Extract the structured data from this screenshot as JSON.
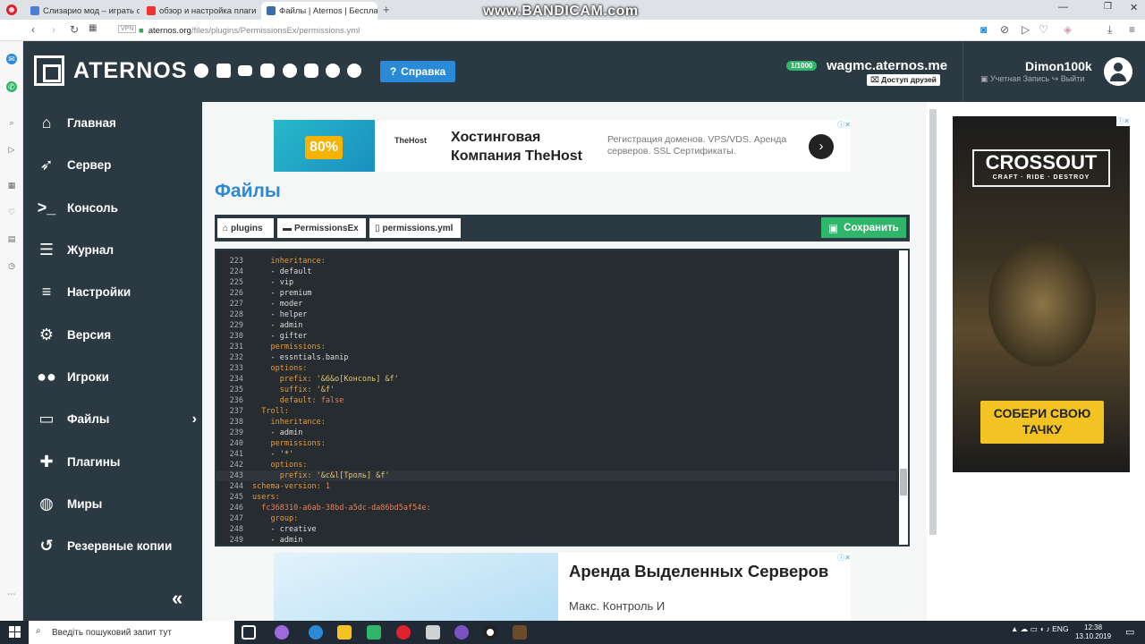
{
  "browser": {
    "tabs": [
      {
        "title": "Слизарио мод – играть он",
        "color": "#4a7fd4"
      },
      {
        "title": "обзор и настройка плаги",
        "color": "#e33"
      },
      {
        "title": "Файлы | Aternos | Бесплат",
        "color": "#3b6ea8"
      }
    ],
    "url_host": "aternos.org",
    "url_path": "/files/plugins/PermissionsEx/permissions.yml",
    "vpn_label": "VPN",
    "new_tab": "+"
  },
  "watermark": "www.BANDICAM.com",
  "header": {
    "logo_text": "ATERNOS",
    "help_label": "Справка",
    "server_badge": "1/1000",
    "server_name": "wagmc.aternos.me",
    "friends_label": "Доступ друзей",
    "user_name": "Dimon100k",
    "account_label": "Учетная Запись",
    "logout_label": "Выйти"
  },
  "sidebar": {
    "items": [
      {
        "label": "Главная",
        "icon": "home-icon"
      },
      {
        "label": "Сервер",
        "icon": "rocket-icon"
      },
      {
        "label": "Консоль",
        "icon": "terminal-icon"
      },
      {
        "label": "Журнал",
        "icon": "log-icon"
      },
      {
        "label": "Настройки",
        "icon": "sliders-icon"
      },
      {
        "label": "Версия",
        "icon": "gears-icon"
      },
      {
        "label": "Игроки",
        "icon": "users-icon"
      },
      {
        "label": "Файлы",
        "icon": "folder-icon"
      },
      {
        "label": "Плагины",
        "icon": "puzzle-icon"
      },
      {
        "label": "Миры",
        "icon": "globe-icon"
      },
      {
        "label": "Резервные копии",
        "icon": "restore-icon"
      }
    ],
    "collapse_label": "«"
  },
  "ad_top": {
    "badge": "80%",
    "brand": "TheHost",
    "title": "Хостинговая Компания TheHost",
    "desc": "Регистрация доменов. VPS/VDS. Аренда серверов. SSL Сертификаты."
  },
  "files": {
    "title": "Файлы",
    "breadcrumbs": [
      "plugins",
      "PermissionsEx",
      "permissions.yml"
    ],
    "save_label": "Сохранить"
  },
  "editor": {
    "lines": [
      {
        "n": "223",
        "t": "    <span class='k'>inheritance:</span>"
      },
      {
        "n": "224",
        "t": "    <span class='v'>- default</span>"
      },
      {
        "n": "225",
        "t": "    <span class='v'>- vip</span>"
      },
      {
        "n": "226",
        "t": "    <span class='v'>- premium</span>"
      },
      {
        "n": "227",
        "t": "    <span class='v'>- moder</span>"
      },
      {
        "n": "228",
        "t": "    <span class='v'>- helper</span>"
      },
      {
        "n": "229",
        "t": "    <span class='v'>- admin</span>"
      },
      {
        "n": "230",
        "t": "    <span class='v'>- gifter</span>"
      },
      {
        "n": "231",
        "t": "    <span class='k'>permissions:</span>"
      },
      {
        "n": "232",
        "t": "    <span class='v'>- essntials.banip</span>"
      },
      {
        "n": "233",
        "t": "    <span class='k'>options:</span>"
      },
      {
        "n": "234",
        "t": "      <span class='k'>prefix:</span> <span class='s'>'&amp;6&amp;o[Консоль] &amp;f'</span>"
      },
      {
        "n": "235",
        "t": "      <span class='k'>suffix:</span> <span class='s'>'&amp;f'</span>"
      },
      {
        "n": "236",
        "t": "      <span class='k'>default:</span> <span class='u'>false</span>"
      },
      {
        "n": "237",
        "t": "  <span class='k'>Troll:</span>"
      },
      {
        "n": "238",
        "t": "    <span class='k'>inheritance:</span>"
      },
      {
        "n": "239",
        "t": "    <span class='v'>- admin</span>"
      },
      {
        "n": "240",
        "t": "    <span class='k'>permissions:</span>"
      },
      {
        "n": "241",
        "t": "    <span class='v'>- </span><span class='s'>'*'</span>"
      },
      {
        "n": "242",
        "t": "    <span class='k'>options:</span>"
      },
      {
        "n": "243",
        "t": "      <span class='k'>prefix:</span> <span class='s'>'&amp;c&amp;l[Троль] &amp;f'</span>"
      },
      {
        "n": "244",
        "t": "<span class='k'>schema-version:</span> <span class='u'>1</span>"
      },
      {
        "n": "245",
        "t": "<span class='k'>users:</span>"
      },
      {
        "n": "246",
        "t": "  <span class='u'>fc368310-a6ab-38bd-a5dc-da86bd5af54e:</span>"
      },
      {
        "n": "247",
        "t": "    <span class='k'>group:</span>"
      },
      {
        "n": "248",
        "t": "    <span class='v'>- creative</span>"
      },
      {
        "n": "249",
        "t": "    <span class='v'>- admin</span>"
      }
    ]
  },
  "ad_bottom": {
    "title": "Аренда Выделенных Серверов",
    "desc": "Макс. Контроль И"
  },
  "right_ad": {
    "title": "CROSSOUT",
    "subtitle": "CRAFT · RIDE · DESTROY",
    "cta": "СОБЕРИ СВОЮ ТАЧКУ"
  },
  "taskbar": {
    "search_placeholder": "Введіть пошуковий запит тут",
    "lang": "ENG",
    "time": "12:38",
    "date": "13.10.2019"
  }
}
